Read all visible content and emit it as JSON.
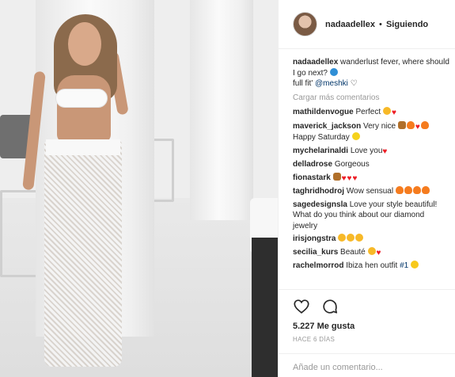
{
  "post": {
    "username": "nadaadellex",
    "separator": "•",
    "follow_status": "Siguiendo"
  },
  "caption": {
    "username": "nadaadellex",
    "text": "wanderlust fever, where should I go next?",
    "line2_prefix": "full fit'",
    "mention": "@meshki",
    "line2_suffix": "♡"
  },
  "load_more": "Cargar más comentarios",
  "comments": [
    {
      "user": "mathildenvogue",
      "text": "Perfect",
      "emojis": [
        "star",
        "heart"
      ]
    },
    {
      "user": "maverick_jackson",
      "text": "Very nice",
      "emojis": [
        "hands",
        "fire",
        "heart",
        "fire"
      ],
      "text2": "Happy Saturday",
      "emojis2": [
        "sun"
      ]
    },
    {
      "user": "mychelarinaldi",
      "text": "Love you",
      "emojis": [
        "heart"
      ]
    },
    {
      "user": "delladrose",
      "text": "Gorgeous",
      "emojis": []
    },
    {
      "user": "fionastark",
      "text": "",
      "emojis": [
        "hands",
        "heart",
        "heart",
        "heart"
      ]
    },
    {
      "user": "taghridhodroj",
      "text": "Wow sensual",
      "emojis": [
        "fire",
        "fire",
        "fire",
        "fire"
      ]
    },
    {
      "user": "sagedesignsla",
      "text": "Love your style beautiful! What do you think about our diamond jewelry",
      "emojis": []
    },
    {
      "user": "irisjongstra",
      "text": "",
      "emojis": [
        "star",
        "star",
        "star"
      ]
    },
    {
      "user": "secilia_kurs",
      "text": "Beauté",
      "emojis": [
        "star",
        "heart"
      ]
    },
    {
      "user": "rachelmorrod",
      "text": "Ibiza hen outfit",
      "tag": "#1",
      "emojis": [
        "grin"
      ]
    }
  ],
  "actions": {
    "like_icon": "heart-outline-icon",
    "comment_icon": "comment-bubble-icon",
    "likes": "5.227 Me gusta",
    "time": "HACE 6 DÍAS"
  },
  "add_comment": {
    "placeholder": "Añade un comentario..."
  }
}
